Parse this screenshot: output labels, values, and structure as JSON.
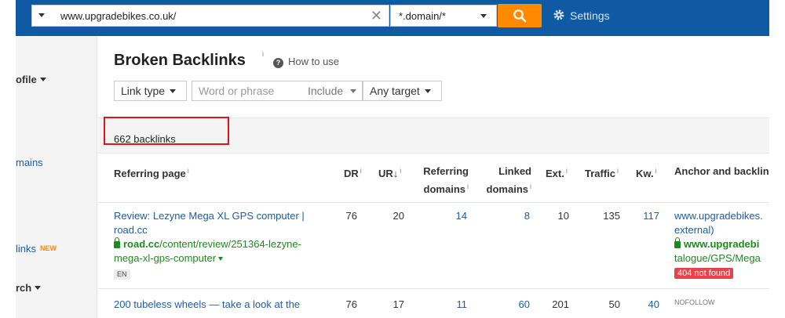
{
  "topbar": {
    "url": "www.upgradebikes.co.uk/",
    "clear_icon": "close-icon",
    "mode": "*.domain/*",
    "search_icon": "search-icon",
    "settings_label": "Settings",
    "colors": {
      "bar": "#0f5aa3",
      "search_button": "#ff8a00"
    }
  },
  "sidebar": {
    "profile_label": "ofile",
    "domains_label": "mains",
    "links_label": "links",
    "new_badge": "NEW",
    "search_label": "rch"
  },
  "main": {
    "title": "Broken Backlinks",
    "title_info": "i",
    "how_to_use": "How to use",
    "filters": {
      "link_type": "Link type",
      "phrase_placeholder": "Word or phrase",
      "include": "Include",
      "target": "Any target"
    },
    "count": "662 backlinks"
  },
  "table": {
    "headers": {
      "referring_page": "Referring page",
      "dr": "DR",
      "ur": "UR",
      "ur_sort": "↓",
      "referring_domains_1": "Referring",
      "referring_domains_2": "domains",
      "linked_domains_1": "Linked",
      "linked_domains_2": "domains",
      "ext": "Ext.",
      "traffic": "Traffic",
      "kw": "Kw.",
      "anchor": "Anchor and backlink"
    },
    "rows": [
      {
        "title": "Review: Lezyne Mega XL GPS computer | road.cc",
        "domain": "road.cc",
        "path": "/content/review/251364-lezyne-mega-xl-gps-computer",
        "lang": "EN",
        "dr": "76",
        "ur": "20",
        "referring_domains": "14",
        "linked_domains": "8",
        "ext": "10",
        "traffic": "135",
        "kw": "117",
        "anchor_line1": "www.upgradebikes.",
        "anchor_line2": "external)",
        "backlink_domain": "www.upgradebi",
        "backlink_path": "talogue/GPS/Mega",
        "status": "404 not found"
      }
    ],
    "partial_row": {
      "title": "200 tubeless wheels — take a look at the",
      "dr": "76",
      "ur": "17",
      "referring_domains": "11",
      "linked_domains": "60",
      "ext": "201",
      "traffic": "50",
      "kw": "40",
      "anchor": "NOFOLLOW"
    }
  }
}
